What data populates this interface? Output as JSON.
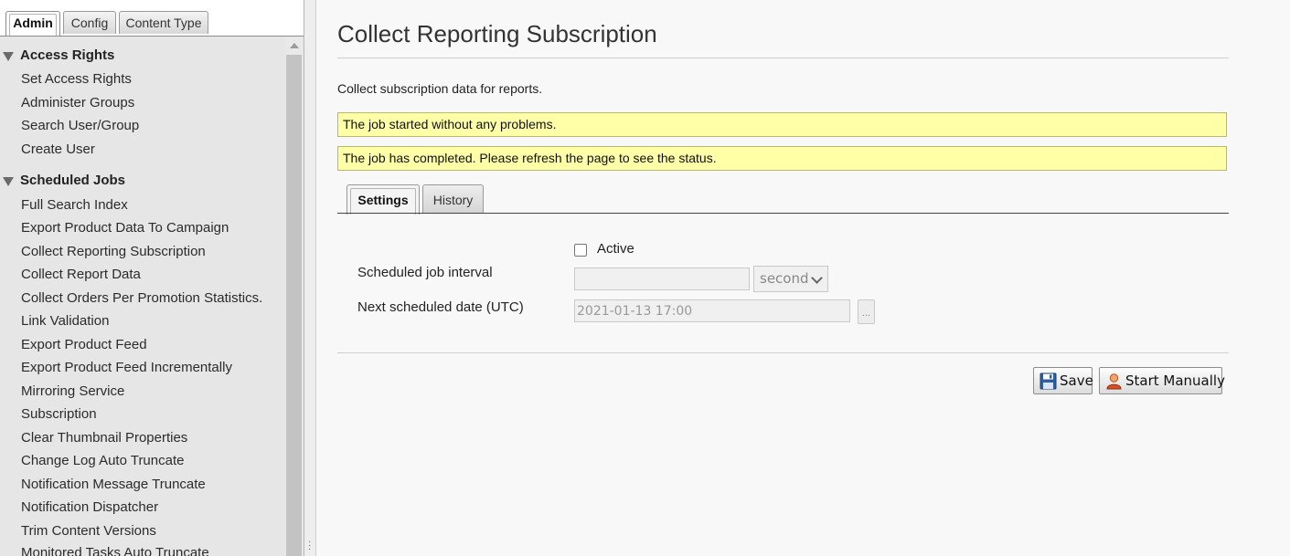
{
  "sidebar": {
    "tabs": [
      {
        "label": "Admin",
        "active": true
      },
      {
        "label": "Config",
        "active": false
      },
      {
        "label": "Content Type",
        "active": false
      }
    ],
    "groups": [
      {
        "title": "Access Rights",
        "items": [
          "Set Access Rights",
          "Administer Groups",
          "Search User/Group",
          "Create User"
        ]
      },
      {
        "title": "Scheduled Jobs",
        "items": [
          "Full Search Index",
          "Export Product Data To Campaign",
          "Collect Reporting Subscription",
          "Collect Report Data",
          "Collect Orders Per Promotion Statistics.",
          "Link Validation",
          "Export Product Feed",
          "Export Product Feed Incrementally",
          "Mirroring Service",
          "Subscription",
          "Clear Thumbnail Properties",
          "Change Log Auto Truncate",
          "Notification Message Truncate",
          "Notification Dispatcher",
          "Trim Content Versions",
          "Monitored Tasks Auto Truncate"
        ]
      }
    ]
  },
  "main": {
    "title": "Collect Reporting Subscription",
    "description": "Collect subscription data for reports.",
    "notices": [
      "The job started without any problems.",
      "The job has completed. Please refresh the page to see the status."
    ],
    "tabs": [
      {
        "label": "Settings",
        "active": true
      },
      {
        "label": "History",
        "active": false
      }
    ],
    "form": {
      "active_label": "Active",
      "active_checked": false,
      "interval_label": "Scheduled job interval",
      "interval_value": "",
      "interval_unit": "second",
      "next_date_label": "Next scheduled date (UTC)",
      "next_date_value": "2021-01-13 17:00",
      "picker_label": "..."
    },
    "buttons": {
      "save": "Save",
      "start": "Start Manually"
    }
  },
  "colors": {
    "notice_bg": "#ffffa8",
    "sidebar_bg": "#e6e6e6"
  }
}
